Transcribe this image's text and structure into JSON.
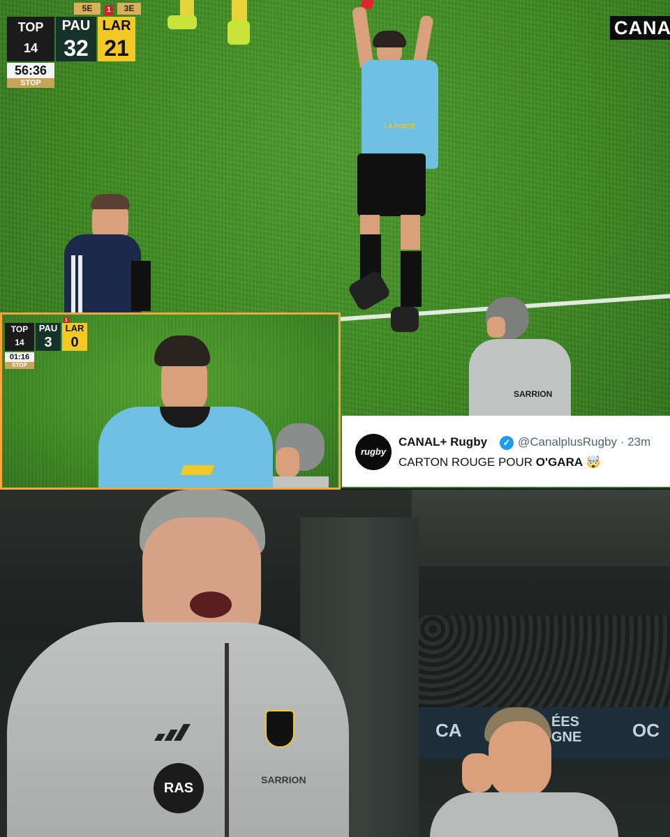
{
  "top_scorebug": {
    "competition": "TOP 14",
    "home_team": "PAU",
    "away_team": "LAR",
    "home_score": "32",
    "away_score": "21",
    "home_rank": "5E",
    "away_rank": "3E",
    "red_cards_away": "1",
    "clock": "56:36",
    "status": "STOP"
  },
  "broadcaster": "CANAL",
  "inset_scorebug": {
    "competition": "TOP 14",
    "home_team": "PAU",
    "away_team": "LAR",
    "home_score": "3",
    "away_score": "0",
    "red_cards_away": "1",
    "clock": "01:16",
    "status": "STOP"
  },
  "referee_shirt_sponsor": "LA POSTE",
  "coach_jacket_sponsor": "SARRION",
  "tweet": {
    "avatar_text": "rugby",
    "display_name": "CANAL+ Rugby",
    "handle_time": "@CanalplusRugby · 23m",
    "text_prefix": "CARTON ROUGE POUR ",
    "text_bold": "O'GARA",
    "emoji": "🤯"
  },
  "bottom_scene": {
    "jacket_badge": "RAS",
    "jacket_brand": "SARRION",
    "board_left": "CA",
    "board_mid": "ÉES\nGNE",
    "board_right": "OC"
  }
}
